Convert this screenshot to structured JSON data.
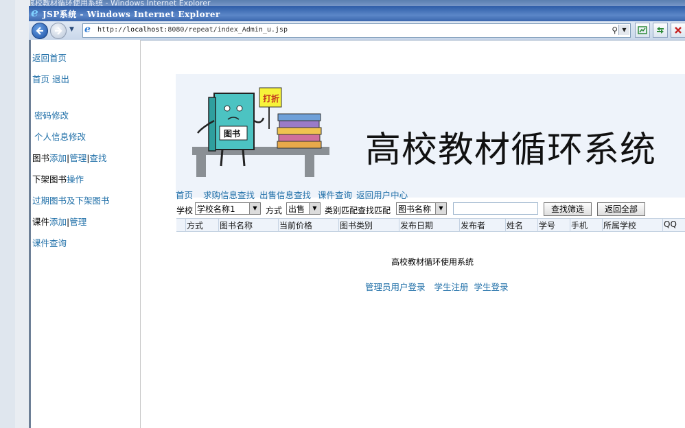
{
  "background_window": {
    "title": "高校教材循环使用系统 - Windows Internet Explorer"
  },
  "window": {
    "title": "JSP系统 - Windows Internet Explorer"
  },
  "address_bar": {
    "url_prefix": "http://",
    "url_host": "localhost",
    "url_rest": ":8080/repeat/index_Admin_u.jsp"
  },
  "sidebar": {
    "items": [
      {
        "link": "返回首页"
      },
      {
        "link": "首页 退出"
      },
      {
        "link": "密码修改"
      },
      {
        "link": "个人信息修改"
      },
      {
        "text": "图书",
        "links": [
          "添加",
          "管理",
          "查找"
        ]
      },
      {
        "text": "下架图书",
        "link": "操作"
      },
      {
        "link": "过期图书及下架图书"
      },
      {
        "text": "课件",
        "links": [
          "添加",
          "管理"
        ]
      },
      {
        "link": "课件查询"
      }
    ]
  },
  "banner": {
    "title": "高校教材循环系统",
    "book_label": "图书",
    "sign_label": "打折"
  },
  "top_nav": [
    "首页",
    "求购信息查找",
    "出售信息查找",
    "课件查询",
    "返回用户中心"
  ],
  "filter": {
    "school_label": "学校",
    "school_value": "学校名称1",
    "mode_label": "方式",
    "mode_value": "出售",
    "category_label": "类别匹配查找匹配",
    "category_value": "图书名称",
    "search_value": "",
    "search_button": "查找筛选",
    "reset_button": "返回全部"
  },
  "table": {
    "columns": [
      "方式",
      "图书名称",
      "当前价格",
      "图书类别",
      "发布日期",
      "发布者",
      "姓名",
      "学号",
      "手机",
      "所属学校",
      "QQ"
    ]
  },
  "footer": {
    "title": "高校教材循环使用系统",
    "links": [
      "管理员用户登录",
      "学生注册",
      "学生登录"
    ]
  }
}
